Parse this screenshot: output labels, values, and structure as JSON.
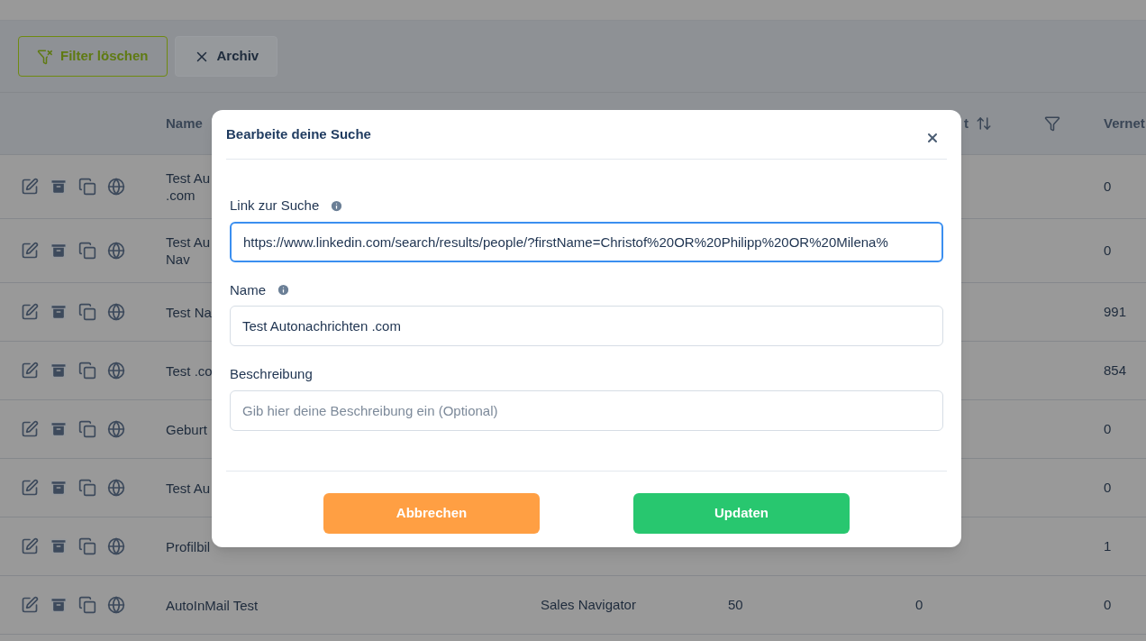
{
  "toolbar": {
    "buttons": [
      {
        "label": "Filter löschen",
        "kind": "filter"
      },
      {
        "label": "Archiv",
        "kind": "close"
      }
    ]
  },
  "table": {
    "columns": [
      {
        "kind": "actions"
      },
      {
        "kind": "text",
        "label": "Name"
      },
      {
        "kind": "hidden"
      },
      {
        "kind": "hidden"
      },
      {
        "kind": "sort",
        "label": "t",
        "filter": true
      },
      {
        "kind": "text",
        "label": "Vernet"
      }
    ],
    "rows": [
      {
        "name": [
          "Test Au",
          ".com"
        ],
        "last": "0"
      },
      {
        "name": [
          "Test Au",
          "Nav"
        ],
        "last": "0"
      },
      {
        "name": [
          "Test Na"
        ],
        "last": "991"
      },
      {
        "name": [
          "Test .co"
        ],
        "last": "854"
      },
      {
        "name": [
          "Geburt"
        ],
        "last": "0"
      },
      {
        "name": [
          "Test Au"
        ],
        "last": "0"
      },
      {
        "name": [
          "Profilbil"
        ],
        "last": "1"
      },
      {
        "name": [
          "AutoInMail Test"
        ],
        "type": "Sales Navigator",
        "col_3": "50",
        "col_4": "0",
        "last": "0"
      }
    ]
  },
  "dialog": {
    "title": "Bearbeite deine Suche",
    "fields": [
      {
        "label": "Link zur Suche",
        "info": true,
        "focused": true,
        "value": "https://www.linkedin.com/search/results/people/?firstName=Christof%20OR%20Philipp%20OR%20Milena%"
      },
      {
        "label": "Name",
        "info": true,
        "focused": false,
        "value": "Test Autonachrichten .com"
      },
      {
        "label": "Beschreibung",
        "info": false,
        "focused": false,
        "placeholder": "Gib hier deine Beschreibung ein (Optional)"
      }
    ],
    "buttons": [
      {
        "label": "Abbrechen",
        "kind": "cancel"
      },
      {
        "label": "Updaten",
        "kind": "confirm"
      }
    ]
  }
}
